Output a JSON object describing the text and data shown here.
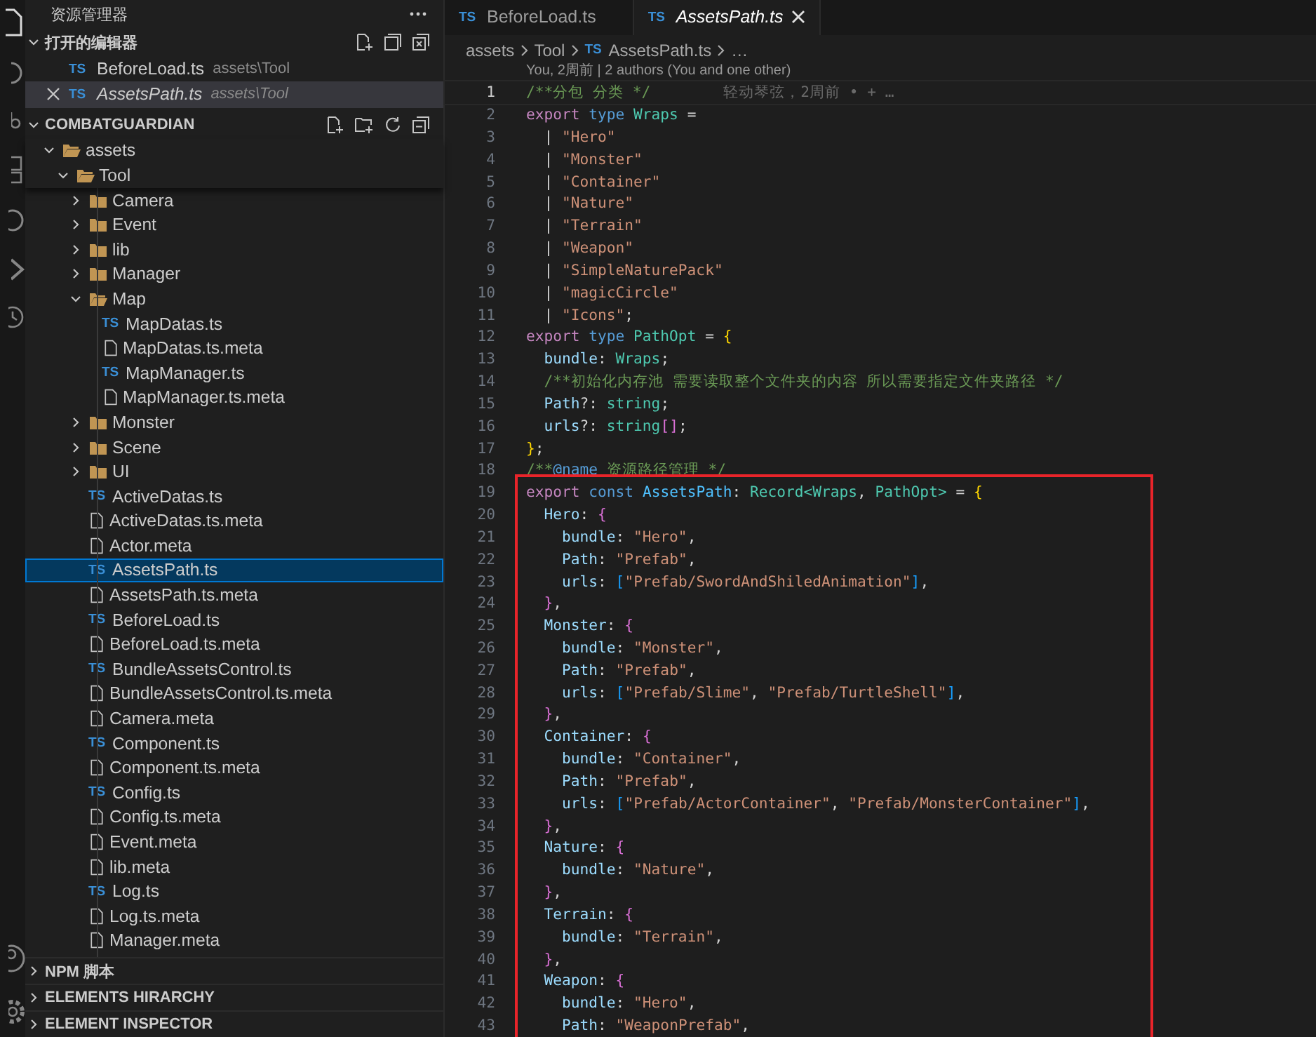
{
  "explorer": {
    "title": "资源管理器",
    "open_editors": {
      "title": "打开的编辑器",
      "expanded": true,
      "items": [
        {
          "icon": "TS",
          "name": "BeforeLoad.ts",
          "path": "assets\\Tool",
          "selected": false,
          "preview": false
        },
        {
          "icon": "TS",
          "name": "AssetsPath.ts",
          "path": "assets\\Tool",
          "selected": true,
          "preview": true
        }
      ]
    },
    "folder": {
      "title": "COMBATGUARDIAN",
      "expanded": true,
      "tree": [
        {
          "name": "assets",
          "kind": "folder",
          "expanded": true,
          "selected": false,
          "children": [
            {
              "name": "Tool",
              "kind": "folder",
              "expanded": true,
              "selected": false,
              "children": [
                {
                  "name": "Camera",
                  "kind": "folder",
                  "expanded": false,
                  "selected": false
                },
                {
                  "name": "Event",
                  "kind": "folder",
                  "expanded": false,
                  "selected": false
                },
                {
                  "name": "lib",
                  "kind": "folder",
                  "expanded": false,
                  "selected": false
                },
                {
                  "name": "Manager",
                  "kind": "folder",
                  "expanded": false,
                  "selected": false
                },
                {
                  "name": "Map",
                  "kind": "folder",
                  "expanded": true,
                  "selected": false,
                  "children": [
                    {
                      "name": "MapDatas.ts",
                      "kind": "file",
                      "icon": "TS",
                      "selected": false
                    },
                    {
                      "name": "MapDatas.ts.meta",
                      "kind": "file",
                      "selected": false
                    },
                    {
                      "name": "MapManager.ts",
                      "kind": "file",
                      "icon": "TS",
                      "selected": false
                    },
                    {
                      "name": "MapManager.ts.meta",
                      "kind": "file",
                      "selected": false
                    }
                  ]
                },
                {
                  "name": "Monster",
                  "kind": "folder",
                  "expanded": false,
                  "selected": false
                },
                {
                  "name": "Scene",
                  "kind": "folder",
                  "expanded": false,
                  "selected": false
                },
                {
                  "name": "UI",
                  "kind": "folder",
                  "expanded": false,
                  "selected": false
                },
                {
                  "name": "ActiveDatas.ts",
                  "kind": "file",
                  "icon": "TS",
                  "selected": false
                },
                {
                  "name": "ActiveDatas.ts.meta",
                  "kind": "file",
                  "selected": false
                },
                {
                  "name": "Actor.meta",
                  "kind": "file",
                  "selected": false
                },
                {
                  "name": "AssetsPath.ts",
                  "kind": "file",
                  "icon": "TS",
                  "selected": true
                },
                {
                  "name": "AssetsPath.ts.meta",
                  "kind": "file",
                  "selected": false
                },
                {
                  "name": "BeforeLoad.ts",
                  "kind": "file",
                  "icon": "TS",
                  "selected": false
                },
                {
                  "name": "BeforeLoad.ts.meta",
                  "kind": "file",
                  "selected": false
                },
                {
                  "name": "BundleAssetsControl.ts",
                  "kind": "file",
                  "icon": "TS",
                  "selected": false
                },
                {
                  "name": "BundleAssetsControl.ts.meta",
                  "kind": "file",
                  "selected": false
                },
                {
                  "name": "Camera.meta",
                  "kind": "file",
                  "selected": false
                },
                {
                  "name": "Component.ts",
                  "kind": "file",
                  "icon": "TS",
                  "selected": false
                },
                {
                  "name": "Component.ts.meta",
                  "kind": "file",
                  "selected": false
                },
                {
                  "name": "Config.ts",
                  "kind": "file",
                  "icon": "TS",
                  "selected": false
                },
                {
                  "name": "Config.ts.meta",
                  "kind": "file",
                  "selected": false
                },
                {
                  "name": "Event.meta",
                  "kind": "file",
                  "selected": false
                },
                {
                  "name": "lib.meta",
                  "kind": "file",
                  "selected": false
                },
                {
                  "name": "Log.ts",
                  "kind": "file",
                  "icon": "TS",
                  "selected": false
                },
                {
                  "name": "Log.ts.meta",
                  "kind": "file",
                  "selected": false
                },
                {
                  "name": "Manager.meta",
                  "kind": "file",
                  "selected": false
                }
              ]
            }
          ]
        }
      ]
    },
    "panels": [
      {
        "title": "NPM 脚本",
        "expanded": false
      },
      {
        "title": "ELEMENTS HIRARCHY",
        "expanded": false
      },
      {
        "title": "ELEMENT INSPECTOR",
        "expanded": false
      }
    ]
  },
  "editor": {
    "tabs": [
      {
        "icon": "TS",
        "name": "BeforeLoad.ts",
        "selected": false,
        "preview": false
      },
      {
        "icon": "TS",
        "name": "AssetsPath.ts",
        "selected": true,
        "preview": true
      }
    ],
    "breadcrumb": [
      {
        "text": "assets"
      },
      {
        "text": "Tool"
      },
      {
        "icon": "TS",
        "text": "AssetsPath.ts"
      },
      {
        "text": "…"
      }
    ],
    "codelens": "You, 2周前 | 2 authors (You and one other)",
    "lines": [
      {
        "number": "1",
        "current": true,
        "blame": "轻动琴弦，2周前 • + …",
        "tokens": [
          {
            "kind": "c",
            "text": "/**分包 分类 */"
          }
        ]
      },
      {
        "number": "2",
        "current": false,
        "tokens": [
          {
            "kind": "kw",
            "text": "export "
          },
          {
            "kind": "st",
            "text": "type "
          },
          {
            "kind": "ty",
            "text": "Wraps"
          },
          {
            "kind": "p",
            "text": " ="
          }
        ]
      },
      {
        "number": "3",
        "current": false,
        "tokens": [
          {
            "kind": "p",
            "text": "  | "
          },
          {
            "kind": "s",
            "text": "\"Hero\""
          }
        ]
      },
      {
        "number": "4",
        "current": false,
        "tokens": [
          {
            "kind": "p",
            "text": "  | "
          },
          {
            "kind": "s",
            "text": "\"Monster\""
          }
        ]
      },
      {
        "number": "5",
        "current": false,
        "tokens": [
          {
            "kind": "p",
            "text": "  | "
          },
          {
            "kind": "s",
            "text": "\"Container\""
          }
        ]
      },
      {
        "number": "6",
        "current": false,
        "tokens": [
          {
            "kind": "p",
            "text": "  | "
          },
          {
            "kind": "s",
            "text": "\"Nature\""
          }
        ]
      },
      {
        "number": "7",
        "current": false,
        "tokens": [
          {
            "kind": "p",
            "text": "  | "
          },
          {
            "kind": "s",
            "text": "\"Terrain\""
          }
        ]
      },
      {
        "number": "8",
        "current": false,
        "tokens": [
          {
            "kind": "p",
            "text": "  | "
          },
          {
            "kind": "s",
            "text": "\"Weapon\""
          }
        ]
      },
      {
        "number": "9",
        "current": false,
        "tokens": [
          {
            "kind": "p",
            "text": "  | "
          },
          {
            "kind": "s",
            "text": "\"SimpleNaturePack\""
          }
        ]
      },
      {
        "number": "10",
        "current": false,
        "tokens": [
          {
            "kind": "p",
            "text": "  | "
          },
          {
            "kind": "s",
            "text": "\"magicCircle\""
          }
        ]
      },
      {
        "number": "11",
        "current": false,
        "tokens": [
          {
            "kind": "p",
            "text": "  | "
          },
          {
            "kind": "s",
            "text": "\"Icons\""
          },
          {
            "kind": "p",
            "text": ";"
          }
        ]
      },
      {
        "number": "12",
        "current": false,
        "tokens": [
          {
            "kind": "kw",
            "text": "export "
          },
          {
            "kind": "st",
            "text": "type "
          },
          {
            "kind": "ty",
            "text": "PathOpt"
          },
          {
            "kind": "p",
            "text": " = "
          },
          {
            "kind": "b1",
            "text": "{"
          }
        ]
      },
      {
        "number": "13",
        "current": false,
        "tokens": [
          {
            "kind": "pr",
            "text": "  bundle"
          },
          {
            "kind": "p",
            "text": ": "
          },
          {
            "kind": "ty",
            "text": "Wraps"
          },
          {
            "kind": "p",
            "text": ";"
          }
        ]
      },
      {
        "number": "14",
        "current": false,
        "tokens": [
          {
            "kind": "c",
            "text": "  /**初始化内存池 需要读取整个文件夹的内容 所以需要指定文件夹路径 */"
          }
        ]
      },
      {
        "number": "15",
        "current": false,
        "tokens": [
          {
            "kind": "pr",
            "text": "  Path"
          },
          {
            "kind": "p",
            "text": "?: "
          },
          {
            "kind": "ty",
            "text": "string"
          },
          {
            "kind": "p",
            "text": ";"
          }
        ]
      },
      {
        "number": "16",
        "current": false,
        "tokens": [
          {
            "kind": "pr",
            "text": "  urls"
          },
          {
            "kind": "p",
            "text": "?: "
          },
          {
            "kind": "ty",
            "text": "string"
          },
          {
            "kind": "b2",
            "text": "[]"
          },
          {
            "kind": "p",
            "text": ";"
          }
        ]
      },
      {
        "number": "17",
        "current": false,
        "tokens": [
          {
            "kind": "b1",
            "text": "}"
          },
          {
            "kind": "p",
            "text": ";"
          }
        ]
      },
      {
        "number": "18",
        "current": false,
        "tokens": [
          {
            "kind": "c",
            "text": "/**"
          },
          {
            "kind": "st",
            "text": "@name"
          },
          {
            "kind": "c",
            "text": " 资源路径管理 */"
          }
        ]
      },
      {
        "number": "19",
        "current": false,
        "tokens": [
          {
            "kind": "kw",
            "text": "export "
          },
          {
            "kind": "st",
            "text": "const "
          },
          {
            "kind": "cv",
            "text": "AssetsPath"
          },
          {
            "kind": "p",
            "text": ": "
          },
          {
            "kind": "ty",
            "text": "Record<Wraps"
          },
          {
            "kind": "p",
            "text": ", "
          },
          {
            "kind": "ty",
            "text": "PathOpt>"
          },
          {
            "kind": "p",
            "text": " = "
          },
          {
            "kind": "b1",
            "text": "{"
          }
        ]
      },
      {
        "number": "20",
        "current": false,
        "tokens": [
          {
            "kind": "pr",
            "text": "  Hero"
          },
          {
            "kind": "p",
            "text": ": "
          },
          {
            "kind": "b2",
            "text": "{"
          }
        ]
      },
      {
        "number": "21",
        "current": false,
        "tokens": [
          {
            "kind": "pr",
            "text": "    bundle"
          },
          {
            "kind": "p",
            "text": ": "
          },
          {
            "kind": "s",
            "text": "\"Hero\""
          },
          {
            "kind": "p",
            "text": ","
          }
        ]
      },
      {
        "number": "22",
        "current": false,
        "tokens": [
          {
            "kind": "pr",
            "text": "    Path"
          },
          {
            "kind": "p",
            "text": ": "
          },
          {
            "kind": "s",
            "text": "\"Prefab\""
          },
          {
            "kind": "p",
            "text": ","
          }
        ]
      },
      {
        "number": "23",
        "current": false,
        "tokens": [
          {
            "kind": "pr",
            "text": "    urls"
          },
          {
            "kind": "p",
            "text": ": "
          },
          {
            "kind": "b3",
            "text": "["
          },
          {
            "kind": "s",
            "text": "\"Prefab/SwordAndShiledAnimation\""
          },
          {
            "kind": "b3",
            "text": "]"
          },
          {
            "kind": "p",
            "text": ","
          }
        ]
      },
      {
        "number": "24",
        "current": false,
        "tokens": [
          {
            "kind": "b2",
            "text": "  }"
          },
          {
            "kind": "p",
            "text": ","
          }
        ]
      },
      {
        "number": "25",
        "current": false,
        "tokens": [
          {
            "kind": "pr",
            "text": "  Monster"
          },
          {
            "kind": "p",
            "text": ": "
          },
          {
            "kind": "b2",
            "text": "{"
          }
        ]
      },
      {
        "number": "26",
        "current": false,
        "tokens": [
          {
            "kind": "pr",
            "text": "    bundle"
          },
          {
            "kind": "p",
            "text": ": "
          },
          {
            "kind": "s",
            "text": "\"Monster\""
          },
          {
            "kind": "p",
            "text": ","
          }
        ]
      },
      {
        "number": "27",
        "current": false,
        "tokens": [
          {
            "kind": "pr",
            "text": "    Path"
          },
          {
            "kind": "p",
            "text": ": "
          },
          {
            "kind": "s",
            "text": "\"Prefab\""
          },
          {
            "kind": "p",
            "text": ","
          }
        ]
      },
      {
        "number": "28",
        "current": false,
        "tokens": [
          {
            "kind": "pr",
            "text": "    urls"
          },
          {
            "kind": "p",
            "text": ": "
          },
          {
            "kind": "b3",
            "text": "["
          },
          {
            "kind": "s",
            "text": "\"Prefab/Slime\""
          },
          {
            "kind": "p",
            "text": ", "
          },
          {
            "kind": "s",
            "text": "\"Prefab/TurtleShell\""
          },
          {
            "kind": "b3",
            "text": "]"
          },
          {
            "kind": "p",
            "text": ","
          }
        ]
      },
      {
        "number": "29",
        "current": false,
        "tokens": [
          {
            "kind": "b2",
            "text": "  }"
          },
          {
            "kind": "p",
            "text": ","
          }
        ]
      },
      {
        "number": "30",
        "current": false,
        "tokens": [
          {
            "kind": "pr",
            "text": "  Container"
          },
          {
            "kind": "p",
            "text": ": "
          },
          {
            "kind": "b2",
            "text": "{"
          }
        ]
      },
      {
        "number": "31",
        "current": false,
        "tokens": [
          {
            "kind": "pr",
            "text": "    bundle"
          },
          {
            "kind": "p",
            "text": ": "
          },
          {
            "kind": "s",
            "text": "\"Container\""
          },
          {
            "kind": "p",
            "text": ","
          }
        ]
      },
      {
        "number": "32",
        "current": false,
        "tokens": [
          {
            "kind": "pr",
            "text": "    Path"
          },
          {
            "kind": "p",
            "text": ": "
          },
          {
            "kind": "s",
            "text": "\"Prefab\""
          },
          {
            "kind": "p",
            "text": ","
          }
        ]
      },
      {
        "number": "33",
        "current": false,
        "tokens": [
          {
            "kind": "pr",
            "text": "    urls"
          },
          {
            "kind": "p",
            "text": ": "
          },
          {
            "kind": "b3",
            "text": "["
          },
          {
            "kind": "s",
            "text": "\"Prefab/ActorContainer\""
          },
          {
            "kind": "p",
            "text": ", "
          },
          {
            "kind": "s",
            "text": "\"Prefab/MonsterContainer\""
          },
          {
            "kind": "b3",
            "text": "]"
          },
          {
            "kind": "p",
            "text": ","
          }
        ]
      },
      {
        "number": "34",
        "current": false,
        "tokens": [
          {
            "kind": "b2",
            "text": "  }"
          },
          {
            "kind": "p",
            "text": ","
          }
        ]
      },
      {
        "number": "35",
        "current": false,
        "tokens": [
          {
            "kind": "pr",
            "text": "  Nature"
          },
          {
            "kind": "p",
            "text": ": "
          },
          {
            "kind": "b2",
            "text": "{"
          }
        ]
      },
      {
        "number": "36",
        "current": false,
        "tokens": [
          {
            "kind": "pr",
            "text": "    bundle"
          },
          {
            "kind": "p",
            "text": ": "
          },
          {
            "kind": "s",
            "text": "\"Nature\""
          },
          {
            "kind": "p",
            "text": ","
          }
        ]
      },
      {
        "number": "37",
        "current": false,
        "tokens": [
          {
            "kind": "b2",
            "text": "  }"
          },
          {
            "kind": "p",
            "text": ","
          }
        ]
      },
      {
        "number": "38",
        "current": false,
        "tokens": [
          {
            "kind": "pr",
            "text": "  Terrain"
          },
          {
            "kind": "p",
            "text": ": "
          },
          {
            "kind": "b2",
            "text": "{"
          }
        ]
      },
      {
        "number": "39",
        "current": false,
        "tokens": [
          {
            "kind": "pr",
            "text": "    bundle"
          },
          {
            "kind": "p",
            "text": ": "
          },
          {
            "kind": "s",
            "text": "\"Terrain\""
          },
          {
            "kind": "p",
            "text": ","
          }
        ]
      },
      {
        "number": "40",
        "current": false,
        "tokens": [
          {
            "kind": "b2",
            "text": "  }"
          },
          {
            "kind": "p",
            "text": ","
          }
        ]
      },
      {
        "number": "41",
        "current": false,
        "tokens": [
          {
            "kind": "pr",
            "text": "  Weapon"
          },
          {
            "kind": "p",
            "text": ": "
          },
          {
            "kind": "b2",
            "text": "{"
          }
        ]
      },
      {
        "number": "42",
        "current": false,
        "tokens": [
          {
            "kind": "pr",
            "text": "    bundle"
          },
          {
            "kind": "p",
            "text": ": "
          },
          {
            "kind": "s",
            "text": "\"Hero\""
          },
          {
            "kind": "p",
            "text": ","
          }
        ]
      },
      {
        "number": "43",
        "current": false,
        "tokens": [
          {
            "kind": "pr",
            "text": "    Path"
          },
          {
            "kind": "p",
            "text": ": "
          },
          {
            "kind": "s",
            "text": "\"WeaponPrefab\""
          },
          {
            "kind": "p",
            "text": ","
          }
        ]
      }
    ]
  }
}
